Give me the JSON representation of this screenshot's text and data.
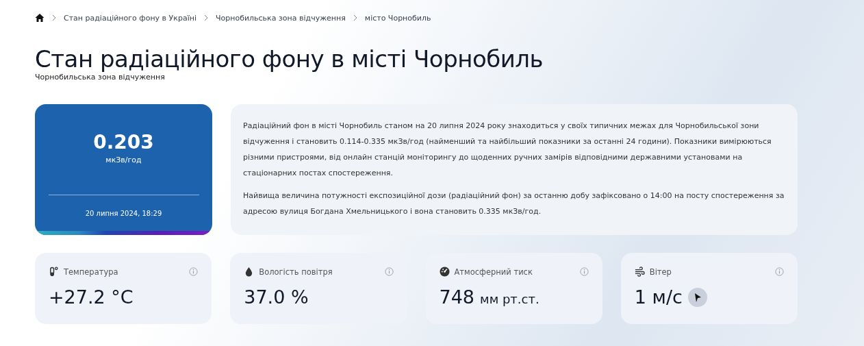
{
  "breadcrumbs": [
    {
      "label": "Стан радіаційного фону в Україні"
    },
    {
      "label": "Чорнобильська зона відчуження"
    },
    {
      "label": "місто Чорнобиль"
    }
  ],
  "title": "Стан радіаційного фону в місті Чорнобиль",
  "subtitle": "Чорнобильська зона відчуження",
  "reading": {
    "value": "0.203",
    "unit": "мкЗв/год",
    "timestamp": "20 липня 2024, 18:29"
  },
  "description": [
    "Радіаційний фон в місті Чорнобиль станом на 20 липня 2024 року знаходиться у своїх типичних межах для Чорнобильської зони відчуження і становить 0.114-0.335 мкЗв/год (найменший та найбільший показники за останні 24 години). Показники вимірюються різними пристроями, від онлайн станцій моніторингу до щоденних ручних замірів відповідними державними установами на стаціонарних постах спостереження.",
    "Найвища величина потужності експозиційної дози (радіаційний фон) за останню добу зафіксовано о 14:00 на посту спостереження за адресою вулиця Богдана Хмельницького і вона становить 0.335 мкЗв/год."
  ],
  "metrics": [
    {
      "kind": "temperature",
      "label": "Температура",
      "value": "+27.2 °C"
    },
    {
      "kind": "humidity",
      "label": "Вологість повітря",
      "value": "37.0 %"
    },
    {
      "kind": "pressure",
      "label": "Атмосферний тиск",
      "value": "748",
      "unit": "мм рт.ст."
    },
    {
      "kind": "wind",
      "label": "Вітер",
      "value": "1 м/с"
    }
  ]
}
